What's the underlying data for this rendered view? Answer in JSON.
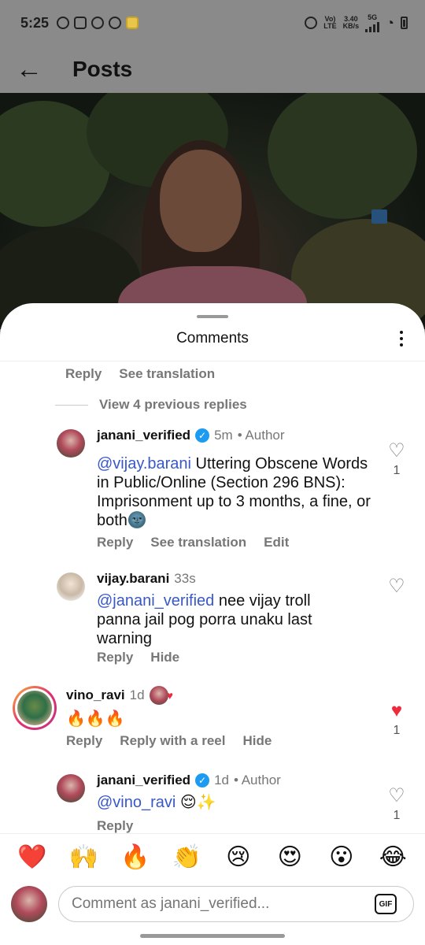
{
  "status_bar": {
    "time": "5:25",
    "net_label_1": "Vo)",
    "net_label_2": "LTE",
    "speed_value": "3.40",
    "speed_unit": "KB/s",
    "network_type": "5G"
  },
  "header": {
    "title": "Posts"
  },
  "sheet": {
    "title": "Comments"
  },
  "top_row_actions": [
    "Reply",
    "See translation"
  ],
  "view_previous": "View 4 previous replies",
  "comments": [
    {
      "user": "janani_verified",
      "time": "5m",
      "author_tag": "• Author",
      "mention": "@vijay.barani",
      "text": " Uttering Obscene Words in Public/Online (Section 296 BNS): Imprisonment up to 3 months, a fine, or both🌚",
      "actions": [
        "Reply",
        "See translation",
        "Edit"
      ],
      "likes": "1"
    },
    {
      "user": "vijay.barani",
      "time": "33s",
      "mention": "@janani_verified",
      "text": " nee vijay troll panna jail pog porra unaku last warning",
      "actions": [
        "Reply",
        "Hide"
      ]
    },
    {
      "user": "vino_ravi",
      "time": "1d",
      "text": "🔥🔥🔥",
      "actions": [
        "Reply",
        "Reply with a reel",
        "Hide"
      ],
      "likes": "1"
    },
    {
      "user": "janani_verified",
      "time": "1d",
      "author_tag": "• Author",
      "mention": "@vino_ravi",
      "text": " 😌✨",
      "actions": [
        "Reply"
      ],
      "likes": "1"
    }
  ],
  "emoji_bar": [
    "❤️",
    "🙌",
    "🔥",
    "👏",
    "😢",
    "😍",
    "😮",
    "😂"
  ],
  "composer": {
    "placeholder": "Comment as janani_verified...",
    "gif_label": "GIF"
  },
  "colors": {
    "mention": "#3858c8",
    "liked_heart": "#ee2a3c",
    "verified_badge": "#1d9bf0"
  }
}
